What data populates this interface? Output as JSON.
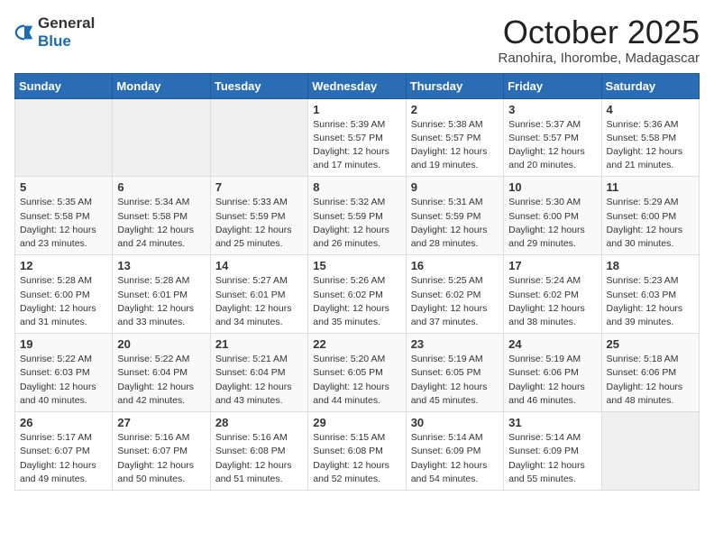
{
  "logo": {
    "general": "General",
    "blue": "Blue"
  },
  "header": {
    "title": "October 2025",
    "subtitle": "Ranohira, Ihorombe, Madagascar"
  },
  "weekdays": [
    "Sunday",
    "Monday",
    "Tuesday",
    "Wednesday",
    "Thursday",
    "Friday",
    "Saturday"
  ],
  "weeks": [
    [
      {
        "day": "",
        "info": ""
      },
      {
        "day": "",
        "info": ""
      },
      {
        "day": "",
        "info": ""
      },
      {
        "day": "1",
        "info": "Sunrise: 5:39 AM\nSunset: 5:57 PM\nDaylight: 12 hours\nand 17 minutes."
      },
      {
        "day": "2",
        "info": "Sunrise: 5:38 AM\nSunset: 5:57 PM\nDaylight: 12 hours\nand 19 minutes."
      },
      {
        "day": "3",
        "info": "Sunrise: 5:37 AM\nSunset: 5:57 PM\nDaylight: 12 hours\nand 20 minutes."
      },
      {
        "day": "4",
        "info": "Sunrise: 5:36 AM\nSunset: 5:58 PM\nDaylight: 12 hours\nand 21 minutes."
      }
    ],
    [
      {
        "day": "5",
        "info": "Sunrise: 5:35 AM\nSunset: 5:58 PM\nDaylight: 12 hours\nand 23 minutes."
      },
      {
        "day": "6",
        "info": "Sunrise: 5:34 AM\nSunset: 5:58 PM\nDaylight: 12 hours\nand 24 minutes."
      },
      {
        "day": "7",
        "info": "Sunrise: 5:33 AM\nSunset: 5:59 PM\nDaylight: 12 hours\nand 25 minutes."
      },
      {
        "day": "8",
        "info": "Sunrise: 5:32 AM\nSunset: 5:59 PM\nDaylight: 12 hours\nand 26 minutes."
      },
      {
        "day": "9",
        "info": "Sunrise: 5:31 AM\nSunset: 5:59 PM\nDaylight: 12 hours\nand 28 minutes."
      },
      {
        "day": "10",
        "info": "Sunrise: 5:30 AM\nSunset: 6:00 PM\nDaylight: 12 hours\nand 29 minutes."
      },
      {
        "day": "11",
        "info": "Sunrise: 5:29 AM\nSunset: 6:00 PM\nDaylight: 12 hours\nand 30 minutes."
      }
    ],
    [
      {
        "day": "12",
        "info": "Sunrise: 5:28 AM\nSunset: 6:00 PM\nDaylight: 12 hours\nand 31 minutes."
      },
      {
        "day": "13",
        "info": "Sunrise: 5:28 AM\nSunset: 6:01 PM\nDaylight: 12 hours\nand 33 minutes."
      },
      {
        "day": "14",
        "info": "Sunrise: 5:27 AM\nSunset: 6:01 PM\nDaylight: 12 hours\nand 34 minutes."
      },
      {
        "day": "15",
        "info": "Sunrise: 5:26 AM\nSunset: 6:02 PM\nDaylight: 12 hours\nand 35 minutes."
      },
      {
        "day": "16",
        "info": "Sunrise: 5:25 AM\nSunset: 6:02 PM\nDaylight: 12 hours\nand 37 minutes."
      },
      {
        "day": "17",
        "info": "Sunrise: 5:24 AM\nSunset: 6:02 PM\nDaylight: 12 hours\nand 38 minutes."
      },
      {
        "day": "18",
        "info": "Sunrise: 5:23 AM\nSunset: 6:03 PM\nDaylight: 12 hours\nand 39 minutes."
      }
    ],
    [
      {
        "day": "19",
        "info": "Sunrise: 5:22 AM\nSunset: 6:03 PM\nDaylight: 12 hours\nand 40 minutes."
      },
      {
        "day": "20",
        "info": "Sunrise: 5:22 AM\nSunset: 6:04 PM\nDaylight: 12 hours\nand 42 minutes."
      },
      {
        "day": "21",
        "info": "Sunrise: 5:21 AM\nSunset: 6:04 PM\nDaylight: 12 hours\nand 43 minutes."
      },
      {
        "day": "22",
        "info": "Sunrise: 5:20 AM\nSunset: 6:05 PM\nDaylight: 12 hours\nand 44 minutes."
      },
      {
        "day": "23",
        "info": "Sunrise: 5:19 AM\nSunset: 6:05 PM\nDaylight: 12 hours\nand 45 minutes."
      },
      {
        "day": "24",
        "info": "Sunrise: 5:19 AM\nSunset: 6:06 PM\nDaylight: 12 hours\nand 46 minutes."
      },
      {
        "day": "25",
        "info": "Sunrise: 5:18 AM\nSunset: 6:06 PM\nDaylight: 12 hours\nand 48 minutes."
      }
    ],
    [
      {
        "day": "26",
        "info": "Sunrise: 5:17 AM\nSunset: 6:07 PM\nDaylight: 12 hours\nand 49 minutes."
      },
      {
        "day": "27",
        "info": "Sunrise: 5:16 AM\nSunset: 6:07 PM\nDaylight: 12 hours\nand 50 minutes."
      },
      {
        "day": "28",
        "info": "Sunrise: 5:16 AM\nSunset: 6:08 PM\nDaylight: 12 hours\nand 51 minutes."
      },
      {
        "day": "29",
        "info": "Sunrise: 5:15 AM\nSunset: 6:08 PM\nDaylight: 12 hours\nand 52 minutes."
      },
      {
        "day": "30",
        "info": "Sunrise: 5:14 AM\nSunset: 6:09 PM\nDaylight: 12 hours\nand 54 minutes."
      },
      {
        "day": "31",
        "info": "Sunrise: 5:14 AM\nSunset: 6:09 PM\nDaylight: 12 hours\nand 55 minutes."
      },
      {
        "day": "",
        "info": ""
      }
    ]
  ]
}
